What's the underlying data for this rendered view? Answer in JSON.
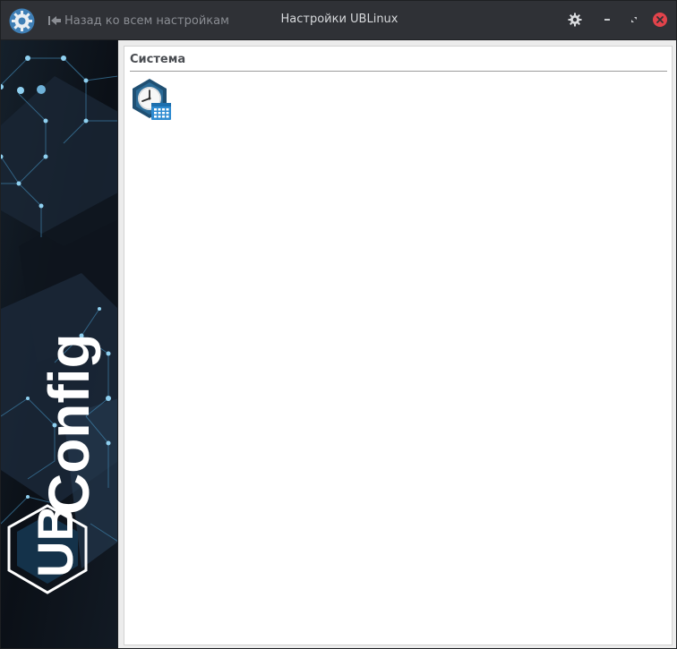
{
  "window": {
    "title": "Настройки UBLinux",
    "back_label": "Назад ко всем настройкам"
  },
  "icons": {
    "app": "ubconfig-gear-icon",
    "back": "back-arrow-icon",
    "settings": "gear-icon",
    "minimize": "minimize-icon",
    "maximize": "maximize-icon",
    "close": "close-icon",
    "module": "date-time-icon"
  },
  "colors": {
    "titlebar": "#2f3136",
    "close": "#e2434b",
    "accent": "#2e8bd1"
  },
  "sidebar": {
    "brand_text": "UBConfig",
    "brand_badge": "UB",
    "brand_word": "Config"
  },
  "main": {
    "section_title": "Система",
    "modules": [
      {
        "icon": "date-time-icon"
      }
    ]
  }
}
